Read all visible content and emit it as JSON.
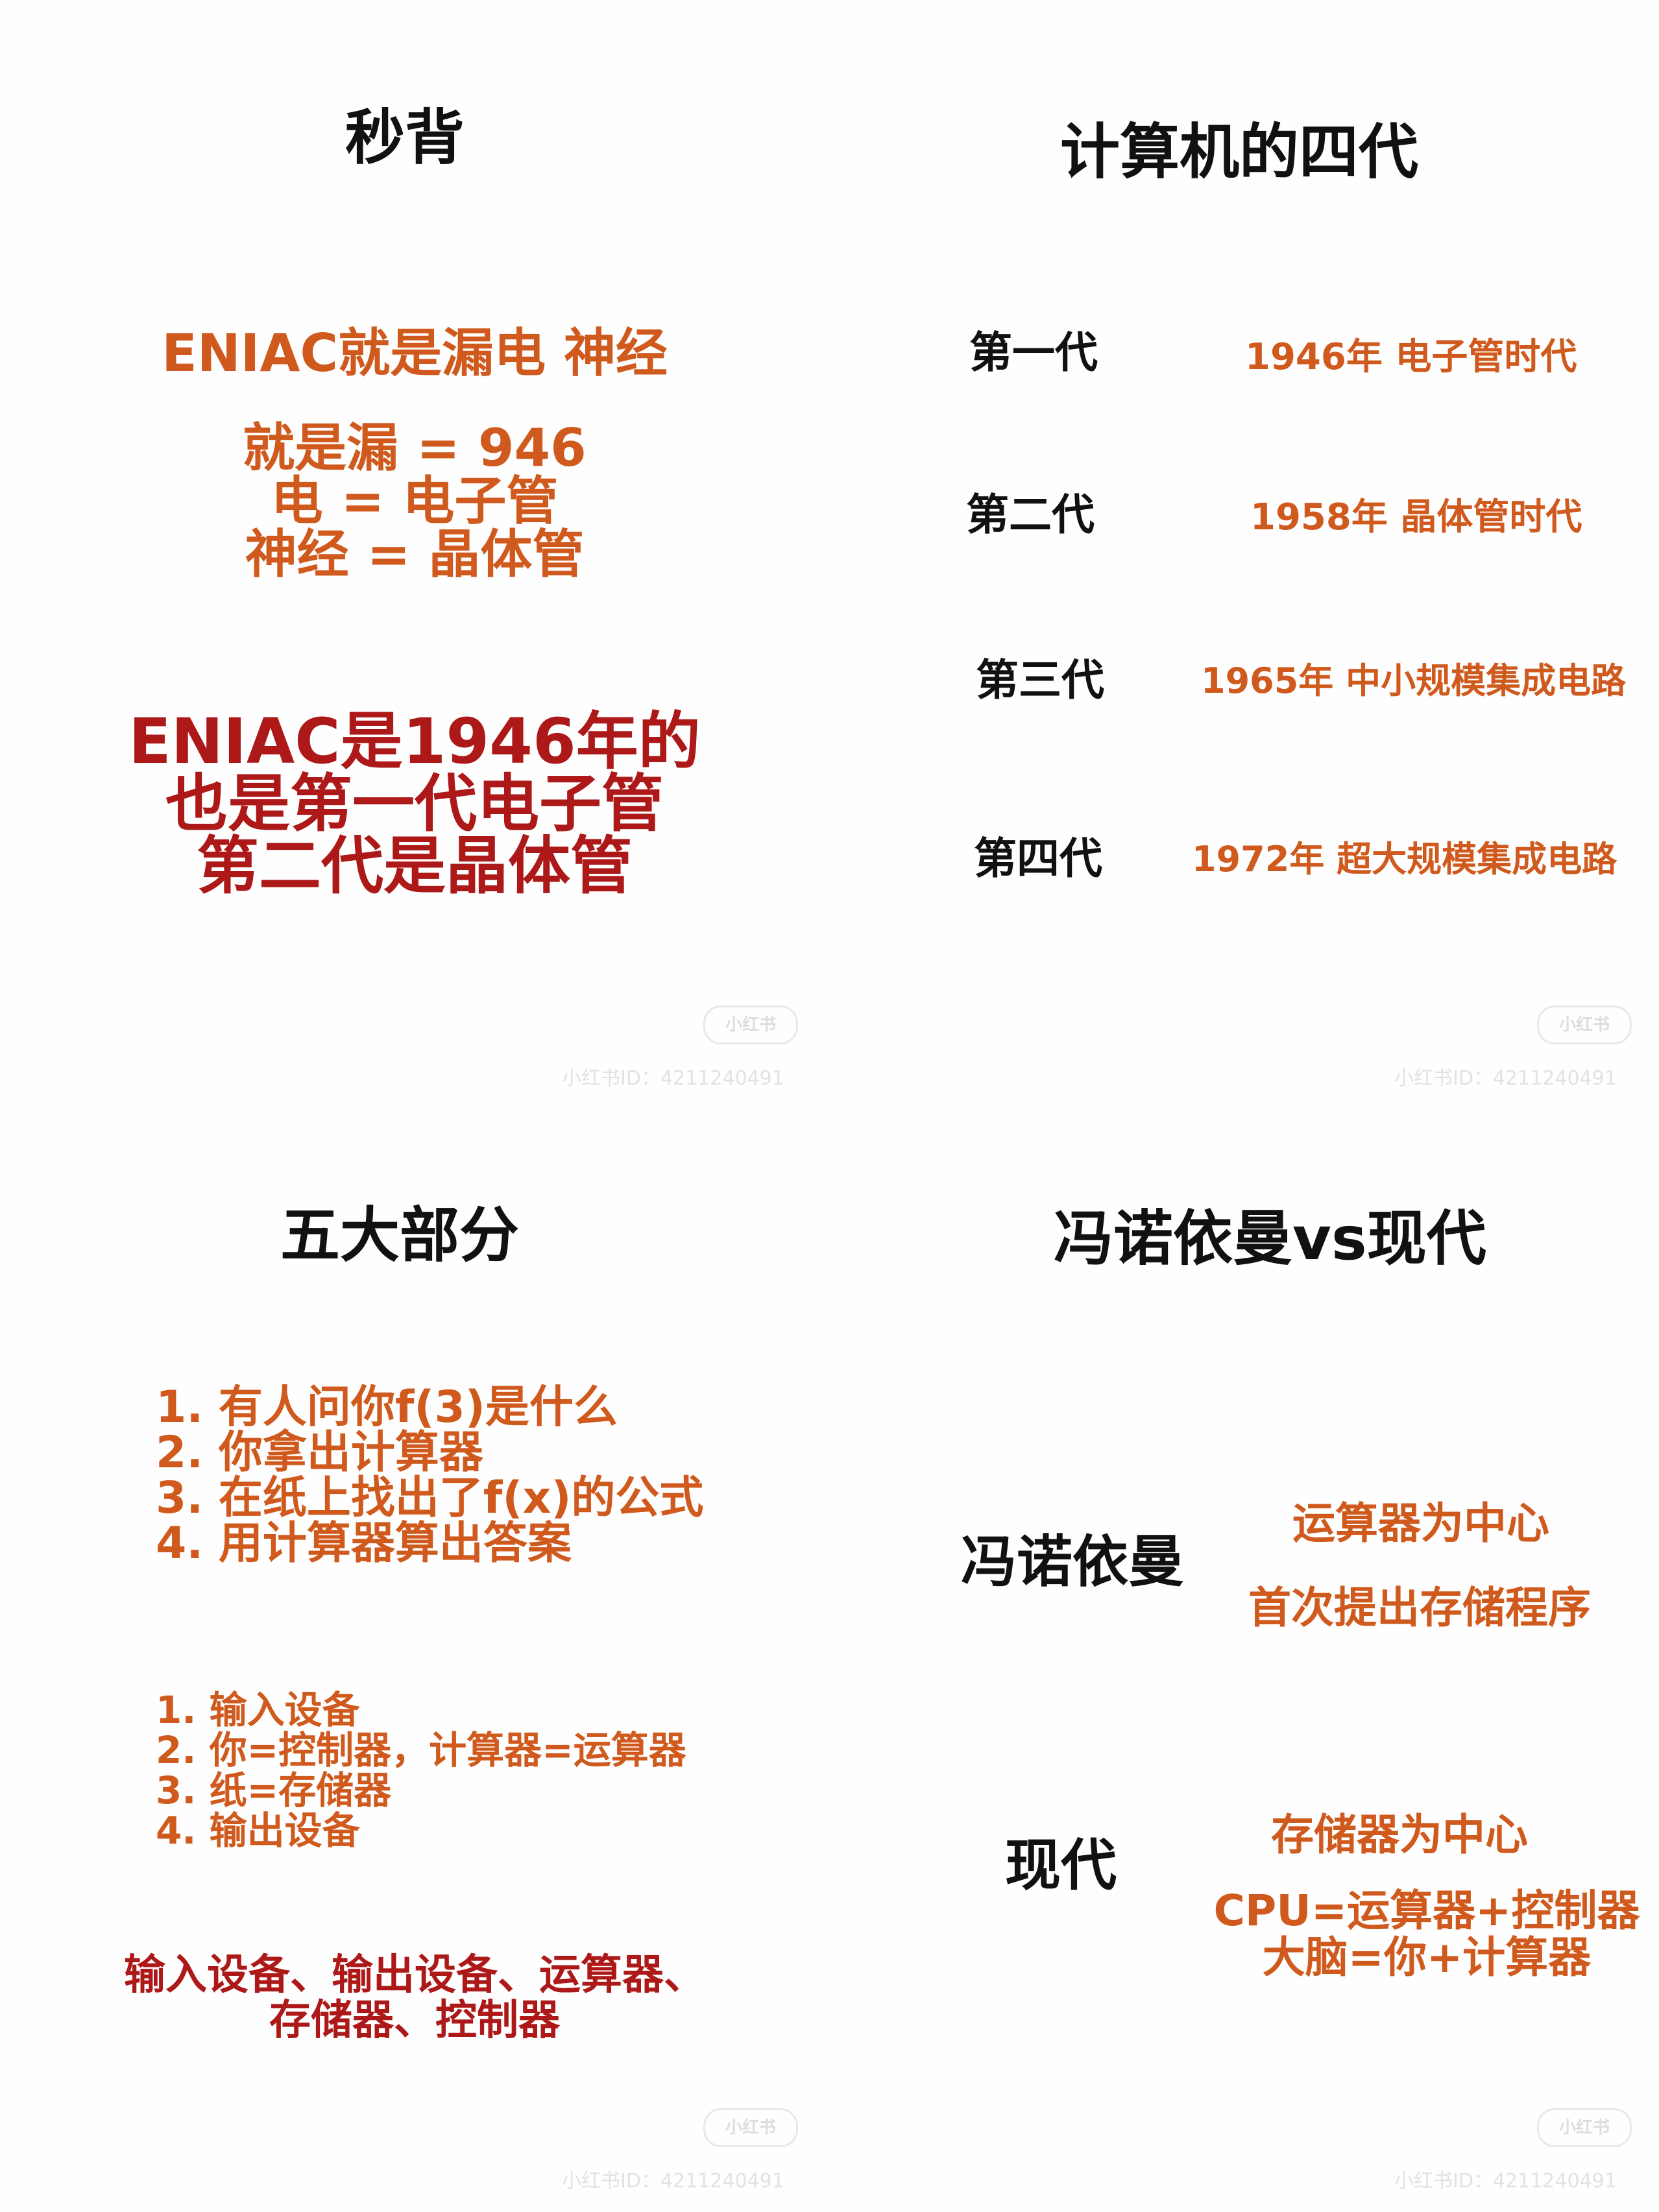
{
  "p1": {
    "title": "秒背",
    "mnemonic": "ENIAC就是漏电 神经",
    "map": [
      "就是漏 = 946",
      "电 = 电子管",
      "神经 = 晶体管"
    ],
    "summary": [
      "ENIAC是1946年的",
      "也是第一代电子管",
      "第二代是晶体管"
    ]
  },
  "p2": {
    "title": "计算机的四代",
    "generations": [
      {
        "label": "第一代",
        "desc": "1946年 电子管时代"
      },
      {
        "label": "第二代",
        "desc": "1958年 晶体管时代"
      },
      {
        "label": "第三代",
        "desc": "1965年 中小规模集成电路"
      },
      {
        "label": "第四代",
        "desc": "1972年 超大规模集成电路"
      }
    ]
  },
  "p3": {
    "title": "五大部分",
    "story": [
      "1. 有人问你f(3)是什么",
      "2. 你拿出计算器",
      "3. 在纸上找出了f(x)的公式",
      "4. 用计算器算出答案"
    ],
    "mapping": [
      "1. 输入设备",
      "2. 你=控制器，计算器=运算器",
      "3. 纸=存储器",
      "4. 输出设备"
    ],
    "summary": [
      "输入设备、输出设备、运算器、",
      "存储器、控制器"
    ]
  },
  "p4": {
    "title": "冯诺依曼vs现代",
    "vn_label": "冯诺依曼",
    "vn_points": [
      "运算器为中心",
      "首次提出存储程序"
    ],
    "modern_label": "现代",
    "modern_points": [
      "存储器为中心",
      "CPU=运算器+控制器",
      "大脑=你+计算器"
    ]
  },
  "watermark": {
    "logo": "小红书",
    "id": "小红书ID：4211240491"
  },
  "colors": {
    "orange": "#d05a1d",
    "red": "#ad1818",
    "black": "#111111"
  }
}
